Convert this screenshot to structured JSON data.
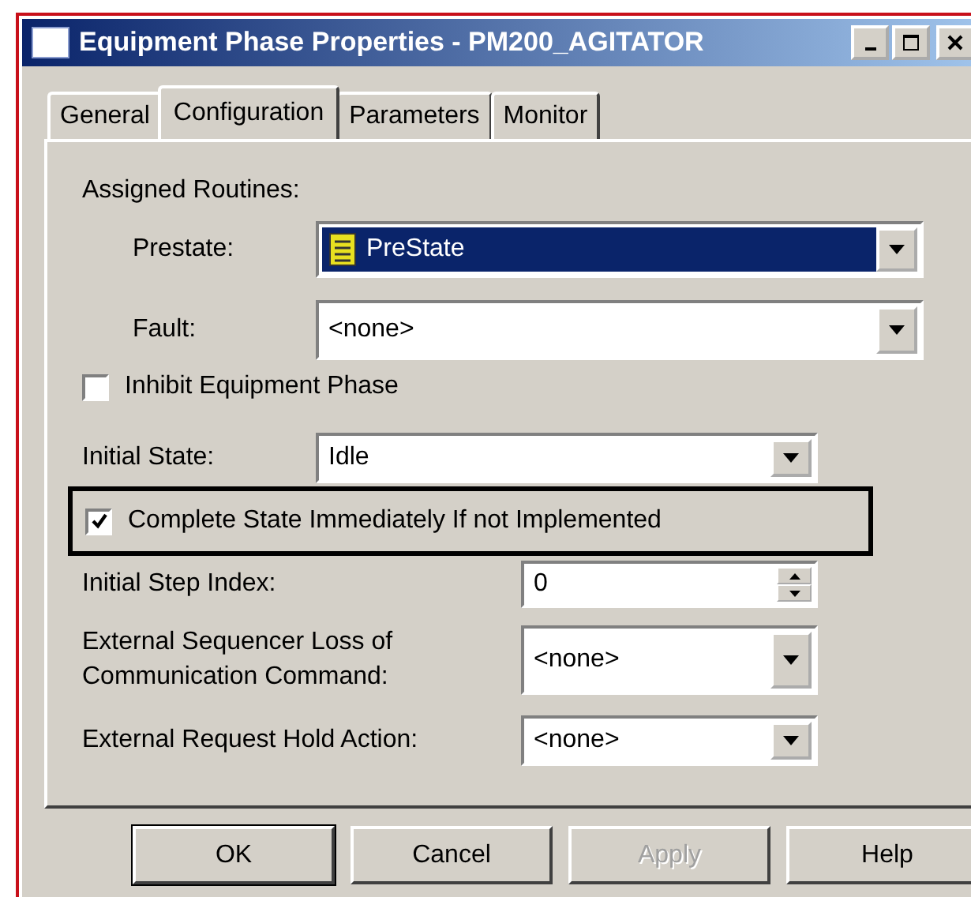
{
  "window": {
    "title": "Equipment Phase Properties - PM200_AGITATOR"
  },
  "tabs": [
    {
      "label": "General",
      "selected": false
    },
    {
      "label": "Configuration",
      "selected": true
    },
    {
      "label": "Parameters",
      "selected": false
    },
    {
      "label": "Monitor",
      "selected": false
    }
  ],
  "assigned_routines": {
    "label": "Assigned Routines:",
    "prestate": {
      "label": "Prestate:",
      "value": "PreState",
      "highlighted": true
    },
    "fault": {
      "label": "Fault:",
      "value": "<none>",
      "highlighted": false
    }
  },
  "inhibit": {
    "label": "Inhibit Equipment Phase",
    "checked": false
  },
  "initial_state": {
    "label": "Initial State:",
    "value": "Idle"
  },
  "complete_state": {
    "label": "Complete State Immediately If not Implemented",
    "checked": true
  },
  "initial_step_index": {
    "label": "Initial Step Index:",
    "value": "0"
  },
  "external_sequencer_loss": {
    "label": "External Sequencer Loss of Communication Command:",
    "value": "<none>"
  },
  "external_request_hold": {
    "label": "External Request Hold Action:",
    "value": "<none>"
  },
  "buttons": [
    {
      "label": "OK",
      "default": true,
      "disabled": false
    },
    {
      "label": "Cancel",
      "default": false,
      "disabled": false
    },
    {
      "label": "Apply",
      "default": false,
      "disabled": true
    },
    {
      "label": "Help",
      "default": false,
      "disabled": false
    }
  ]
}
